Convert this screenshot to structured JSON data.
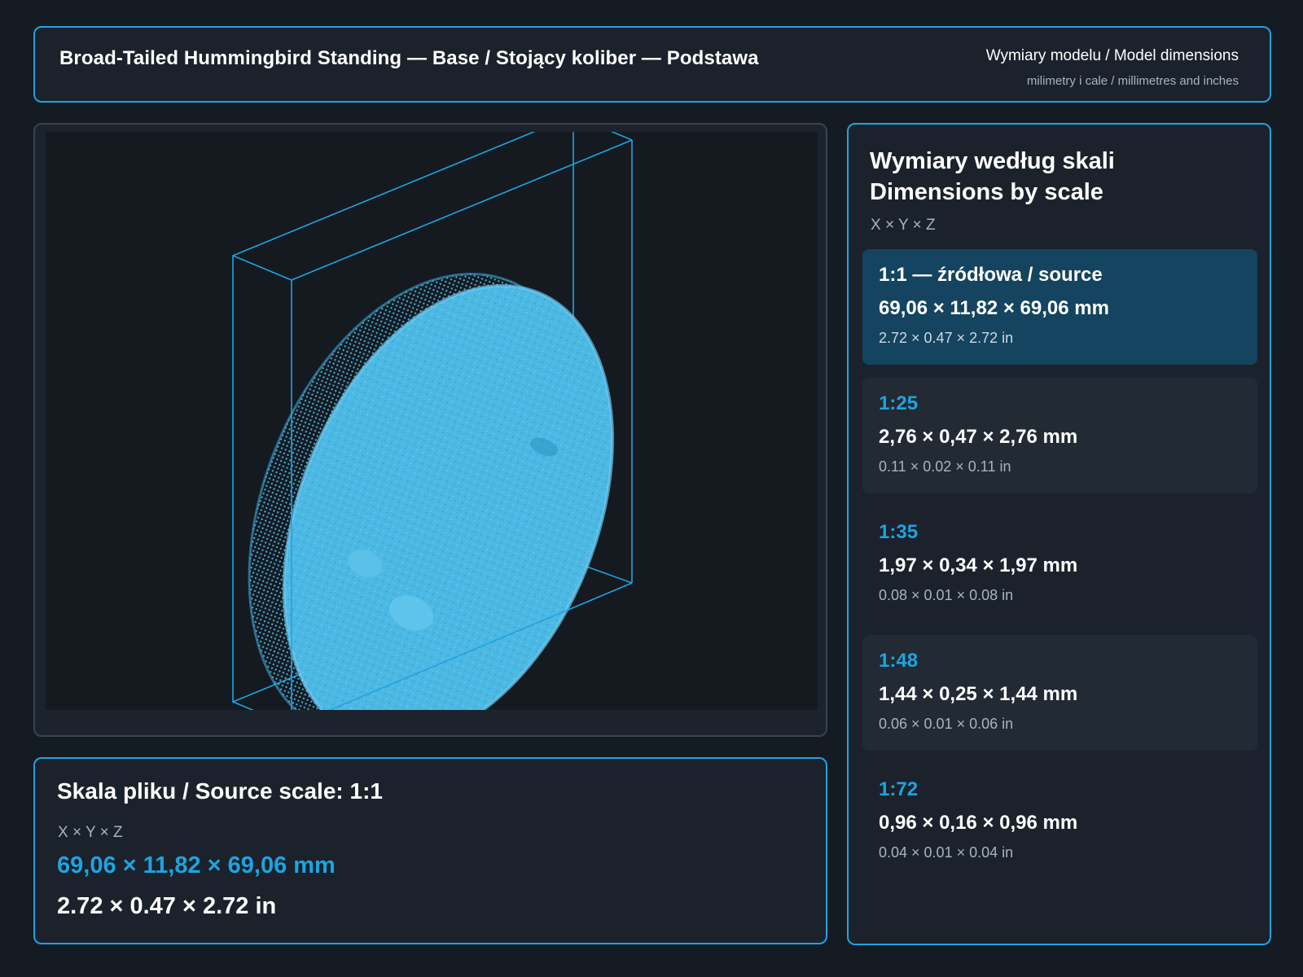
{
  "header": {
    "title": "Broad-Tailed Hummingbird Standing — Base / Stojący koliber — Podstawa",
    "subtitle": "Wymiary modelu / Model dimensions",
    "units_note": "milimetry i cale / millimetres and inches"
  },
  "source": {
    "title": "Skala pliku / Source scale: 1:1",
    "axes": "X × Y × Z",
    "mm": "69,06 × 11,82 × 69,06 mm",
    "inches": "2.72 × 0.47 × 2.72 in"
  },
  "scales": {
    "title_line1": "Wymiary według skali",
    "title_line2": "Dimensions by scale",
    "axes": "X × Y × Z",
    "items": [
      {
        "label": "1:1  —  źródłowa / source",
        "mm": "69,06 × 11,82 × 69,06 mm",
        "inches": "2.72 × 0.47 × 2.72 in"
      },
      {
        "label": "1:25",
        "mm": "2,76 × 0,47 × 2,76 mm",
        "inches": "0.11 × 0.02 × 0.11 in"
      },
      {
        "label": "1:35",
        "mm": "1,97 × 0,34 × 1,97 mm",
        "inches": "0.08 × 0.01 × 0.08 in"
      },
      {
        "label": "1:48",
        "mm": "1,44 × 0,25 × 1,44 mm",
        "inches": "0.06 × 0.01 × 0.06 in"
      },
      {
        "label": "1:72",
        "mm": "0,96 × 0,16 × 0,96 mm",
        "inches": "0.04 × 0.01 × 0.04 in"
      }
    ]
  },
  "colors": {
    "accent": "#1fa3e0",
    "model": "#4cb8e4",
    "background": "#151b23",
    "active_item": "#14445f"
  }
}
